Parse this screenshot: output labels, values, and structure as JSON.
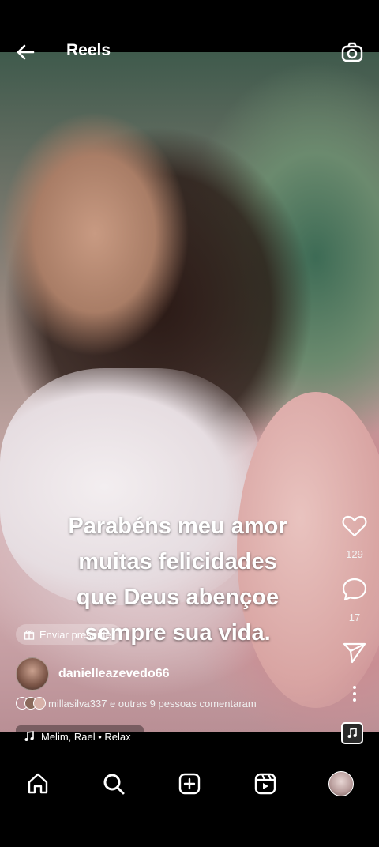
{
  "header": {
    "title": "Reels"
  },
  "icons": {
    "back": "back-arrow-icon",
    "camera": "camera-icon",
    "like": "heart-icon",
    "comment": "comment-icon",
    "share": "send-icon",
    "more": "more-vertical-icon",
    "gift": "gift-icon",
    "music": "music-note-icon"
  },
  "reel": {
    "caption_lines": [
      "Parabéns meu amor",
      "muitas felicidades",
      "que Deus abençoe",
      "sempre sua vida."
    ],
    "likes": "129",
    "comments": "17",
    "gift_label": "Enviar presente",
    "username": "danielleazevedo66",
    "comment_summary": "millasilva337 e outras 9 pessoas comentaram",
    "audio": "Melim, Rael • Relax"
  },
  "nav": {
    "items": [
      "home",
      "search",
      "create",
      "reels",
      "profile"
    ]
  }
}
